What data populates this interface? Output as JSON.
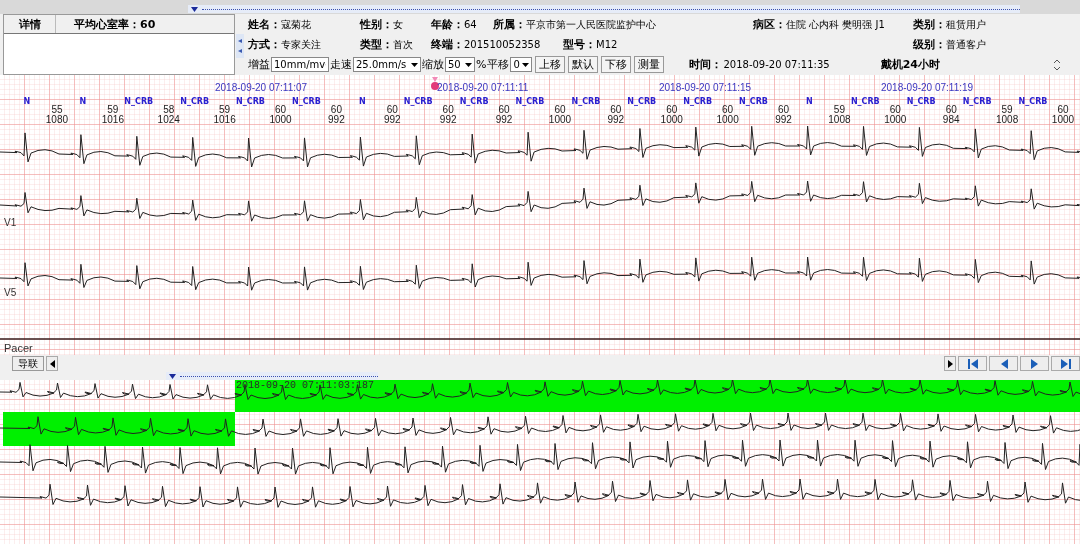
{
  "header": {
    "detail_tab": "详情",
    "avg_rate": "平均心室率：60",
    "fields": [
      [
        {
          "label": "姓名：",
          "value": "寇菊花"
        },
        {
          "label": "性别：",
          "value": "女"
        },
        {
          "label": "年龄：",
          "value": "64"
        },
        {
          "label": "所属：",
          "value": "平京市第一人民医院监护中心"
        },
        {
          "label": "病区：",
          "value": "住院 心内科 樊明强 J1"
        },
        {
          "label": "类别：",
          "value": "租赁用户"
        }
      ],
      [
        {
          "label": "方式：",
          "value": "专家关注"
        },
        {
          "label": "类型：",
          "value": "首次"
        },
        {
          "label": "终端：",
          "value": "201510052358"
        },
        {
          "label": "型号：",
          "value": "M12"
        },
        {
          "label": "级别：",
          "value": "普通客户"
        }
      ]
    ],
    "controls": {
      "gain": {
        "label": "增益",
        "value": "10mm/mv"
      },
      "speed": {
        "label": "走速",
        "value": "25.0mm/s"
      },
      "zoom": {
        "label": "缩放",
        "value": "50",
        "unit": "%"
      },
      "shift": {
        "label": "平移",
        "value": "0"
      },
      "buttons": [
        "上移",
        "默认",
        "下移",
        "测量"
      ]
    },
    "time": {
      "label": "时间：",
      "value": "2018-09-20 07:11:35"
    },
    "duration": "戴机24小时"
  },
  "main_strip": {
    "timestamps": [
      "2018-09-20 07:11:07",
      "2018-09-20 07:11:11",
      "2018-09-20 07:11:15",
      "2018-09-20 07:11:19"
    ],
    "beats": [
      {
        "type": "N"
      },
      {
        "type": "N"
      },
      {
        "type": "N_CRB"
      },
      {
        "type": "N_CRB"
      },
      {
        "type": "N_CRB"
      },
      {
        "type": "N_CRB"
      },
      {
        "type": "N"
      },
      {
        "type": "N_CRB"
      },
      {
        "type": "N_CRB"
      },
      {
        "type": "N_CRB"
      },
      {
        "type": "N_CRB"
      },
      {
        "type": "N_CRB"
      },
      {
        "type": "N_CRB"
      },
      {
        "type": "N_CRB"
      },
      {
        "type": "N"
      },
      {
        "type": "N_CRB"
      },
      {
        "type": "N_CRB"
      },
      {
        "type": "N_CRB"
      },
      {
        "type": "N_CRB"
      }
    ],
    "intervals": [
      {
        "rate": "55",
        "rr": "1080"
      },
      {
        "rate": "59",
        "rr": "1016"
      },
      {
        "rate": "58",
        "rr": "1024"
      },
      {
        "rate": "59",
        "rr": "1016"
      },
      {
        "rate": "60",
        "rr": "1000"
      },
      {
        "rate": "60",
        "rr": "992"
      },
      {
        "rate": "60",
        "rr": "992"
      },
      {
        "rate": "60",
        "rr": "992"
      },
      {
        "rate": "60",
        "rr": "992"
      },
      {
        "rate": "60",
        "rr": "1000"
      },
      {
        "rate": "60",
        "rr": "992"
      },
      {
        "rate": "60",
        "rr": "1000"
      },
      {
        "rate": "60",
        "rr": "1000"
      },
      {
        "rate": "60",
        "rr": "992"
      },
      {
        "rate": "59",
        "rr": "1008"
      },
      {
        "rate": "60",
        "rr": "1000"
      },
      {
        "rate": "60",
        "rr": "984"
      },
      {
        "rate": "59",
        "rr": "1008"
      },
      {
        "rate": "60",
        "rr": "1000"
      }
    ],
    "leads": [
      "V1",
      "V5",
      "Pacer"
    ]
  },
  "toolbar": {
    "lead_button": "导联"
  },
  "detail_strip": {
    "timestamp": "2018-09-20 07:11:03:187"
  }
}
